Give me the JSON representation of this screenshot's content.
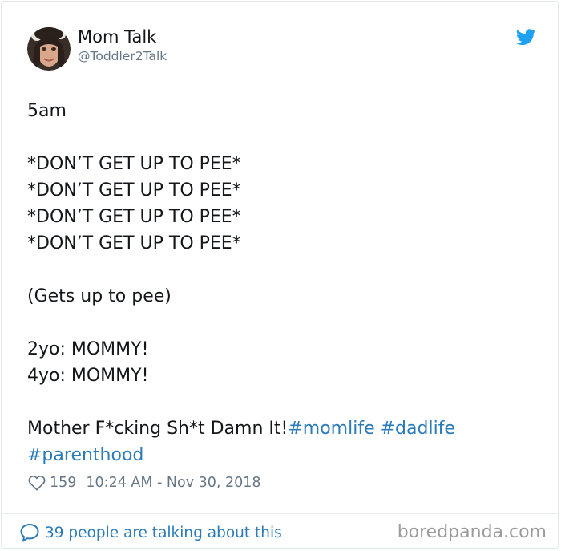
{
  "author": {
    "display_name": "Mom Talk",
    "handle": "@Toddler2Talk"
  },
  "tweet": {
    "lines": [
      "5am",
      "",
      "*DON’T GET UP TO PEE*",
      "*DON’T GET UP TO PEE*",
      "*DON’T GET UP TO PEE*",
      "*DON’T GET UP TO PEE*",
      "",
      "(Gets up to pee)",
      "",
      "2yo: MOMMY!",
      "4yo: MOMMY!",
      ""
    ],
    "final_text": "Mother F*cking Sh*t Damn It!",
    "hashtags": [
      "#momlife",
      "#dadlife",
      "#parenthood"
    ]
  },
  "meta": {
    "likes": "159",
    "timestamp": "10:24 AM - Nov 30, 2018"
  },
  "footer": {
    "talking": "39 people are talking about this",
    "watermark": "boredpanda.com"
  },
  "icons": {
    "brand": "twitter-bird-icon",
    "like": "heart-icon",
    "reply": "speech-bubble-icon"
  },
  "colors": {
    "link": "#2b7bb9",
    "twitter_blue": "#1da1f2",
    "text": "#14171a",
    "muted": "#657786",
    "watermark": "#9b9b9b"
  }
}
